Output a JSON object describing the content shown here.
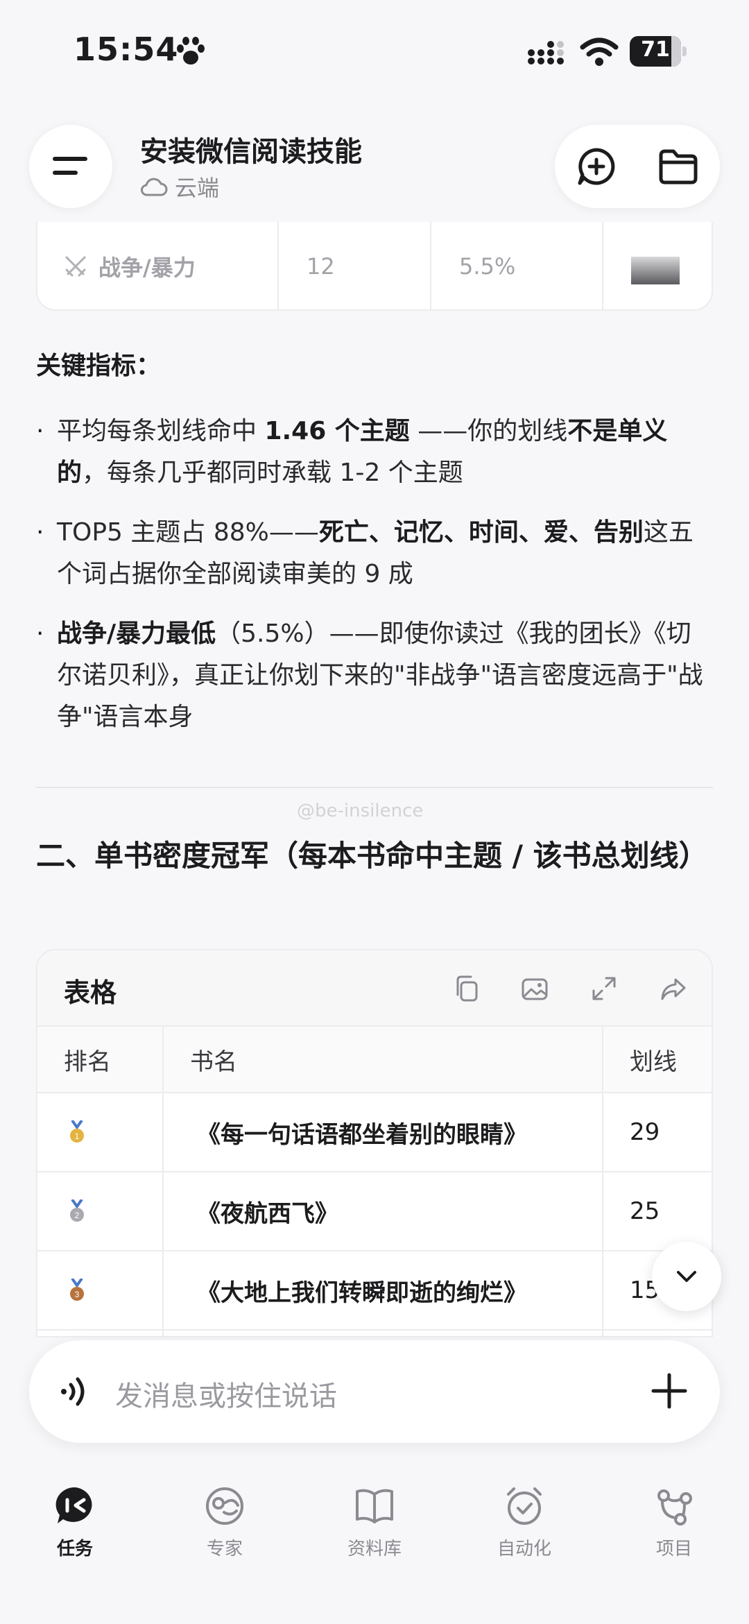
{
  "status_bar": {
    "time": "15:54",
    "battery": "71"
  },
  "header": {
    "title": "安装微信阅读技能",
    "subtitle": "云端"
  },
  "top_table_row": {
    "theme": "战争/暴力",
    "count": "12",
    "percent": "5.5%"
  },
  "key_metrics": {
    "label": "关键指标：",
    "b1": {
      "t1": "平均每条划线命中 ",
      "t2": "1.46 个主题",
      "t3": " ——你的划线",
      "t4": "不是单义的",
      "t5": "，每条几乎都同时承载 1-2 个主题"
    },
    "b2": {
      "t1": "TOP5 主题占 88%——",
      "t2": "死亡、记忆、时间、爱、告别",
      "t3": "这五个词占据你全部阅读审美的 9 成"
    },
    "b3": {
      "t1": "战争/暴力最低",
      "t2": "（5.5%）——即使你读过《我的团长》《切尔诺贝利》，真正让你划下来的\"非战争\"语言密度远高于\"战争\"语言本身"
    }
  },
  "watermark": "@be-insilence",
  "section2": {
    "heading": "二、单书密度冠军（每本书命中主题 / 该书总划线）"
  },
  "table": {
    "title": "表格",
    "headers": [
      "排名",
      "书名",
      "划线"
    ],
    "rows": [
      {
        "rank": "1",
        "book": "《每一句话语都坐着别的眼睛》",
        "lines": "29",
        "medal_color": "#e4b340"
      },
      {
        "rank": "2",
        "book": "《夜航西飞》",
        "lines": "25",
        "medal_color": "#a9a9b0"
      },
      {
        "rank": "3",
        "book": "《大地上我们转瞬即逝的绚烂》",
        "lines": "15",
        "medal_color": "#b8733c"
      }
    ]
  },
  "input": {
    "placeholder": "发消息或按住说话"
  },
  "nav": {
    "items": [
      "任务",
      "专家",
      "资料库",
      "自动化",
      "项目"
    ]
  }
}
